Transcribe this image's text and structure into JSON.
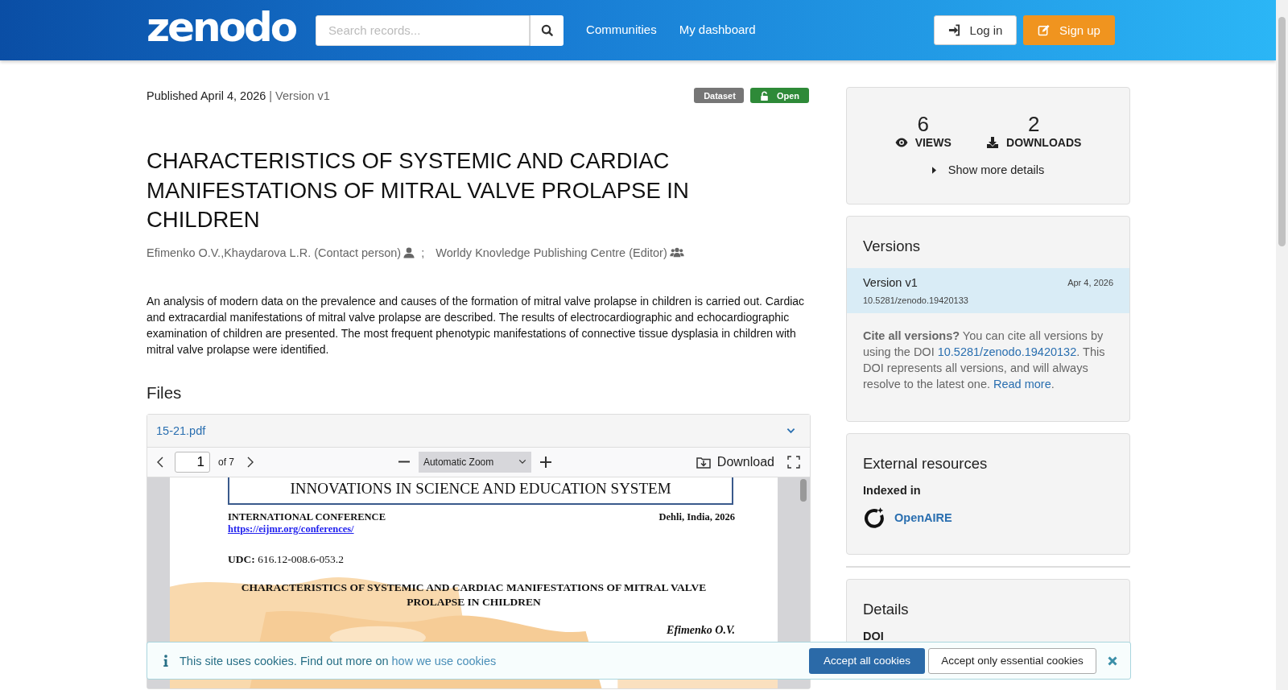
{
  "header": {
    "logo": "zenodo",
    "search": {
      "placeholder": "Search records..."
    },
    "nav": [
      "Communities",
      "My dashboard"
    ],
    "buttons": [
      {
        "label": "Log in",
        "kind": "login"
      },
      {
        "label": "Sign up",
        "kind": "signup"
      }
    ]
  },
  "record": {
    "published": "Published April 4, 2026",
    "version": "| Version v1",
    "badges": [
      {
        "label": "Dataset",
        "kind": "type"
      },
      {
        "label": "Open",
        "kind": "access"
      }
    ],
    "title": "CHARACTERISTICS OF SYSTEMIC AND CARDIAC MANIFESTATIONS OF MITRAL VALVE PROLAPSE IN CHILDREN",
    "creators": [
      {
        "name": "Efimenko O.V.,Khaydarova L.R. (Contact person)",
        "kind": "person"
      },
      {
        "name": "Worldy Knovledge Publishing Centre (Editor)",
        "kind": "group"
      }
    ],
    "creator_separator": ";",
    "description": "An analysis of modern data on the prevalence and causes of the formation of mitral valve prolapse in children is carried out. Cardiac and extracardial manifestations of mitral valve prolapse are described. The results of electrocardiographic and echocardiographic examination of children are presented. The most frequent phenotypic manifestations of connective tissue dysplasia in children with mitral valve prolapse were identified."
  },
  "files": {
    "heading": "Files",
    "file_name": "15-21.pdf",
    "viewer": {
      "page": "1",
      "page_count": "of 7",
      "zoom": "Automatic Zoom",
      "download": "Download",
      "document": {
        "banner": "INNOVATIONS IN SCIENCE AND EDUCATION SYSTEM",
        "conference": "INTERNATIONAL  CONFERENCE",
        "place": "Dehli,  India,  2026",
        "url": "https://eijmr.org/conferences/",
        "udc": "**UDC:** 616.12-008.6-053.2",
        "title": "CHARACTERISTICS OF SYSTEMIC AND CARDIAC MANIFESTATIONS OF MITRAL VALVE PROLAPSE IN CHILDREN",
        "author": "Efimenko O.V."
      }
    }
  },
  "sidebar": {
    "stats": [
      {
        "value": "6",
        "label": "VIEWS",
        "kind": "views"
      },
      {
        "value": "2",
        "label": "DOWNLOADS",
        "kind": "downloads"
      }
    ],
    "show_more": "Show more details",
    "versions": {
      "title": "Versions",
      "items": [
        {
          "label": "Version v1",
          "date": "Apr 4, 2026",
          "doi": "10.5281/zenodo.19420133",
          "selected": true
        }
      ],
      "cite": {
        "lead": "Cite all versions?",
        "text": " You can cite all versions by using the DOI ",
        "doi": "10.5281/zenodo.19420132",
        "text2": ". This DOI represents all versions, and will always resolve to the latest one. ",
        "link": "Read more",
        "end": "."
      }
    },
    "external": {
      "title": "External resources",
      "subtitle": "Indexed in",
      "items": [
        "OpenAIRE"
      ]
    },
    "details": {
      "title": "Details",
      "fields": [
        "DOI"
      ]
    }
  },
  "cookie_banner": {
    "text": "This site uses cookies. Find out more on ",
    "link": "how we use cookies",
    "buttons": [
      {
        "label": "Accept all cookies",
        "kind": "primary"
      },
      {
        "label": "Accept only essential cookies",
        "kind": "secondary"
      }
    ]
  }
}
